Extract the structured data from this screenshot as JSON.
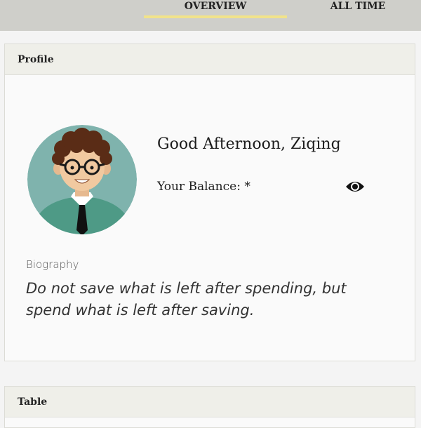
{
  "tabs": [
    {
      "label": "OVERVIEW",
      "active": true
    },
    {
      "label": "ALL TIME",
      "active": false
    }
  ],
  "profile": {
    "header": "Profile",
    "greeting": "Good Afternoon, Ziqing",
    "balance_label": "Your Balance: *",
    "toggle_icon": "eye-icon",
    "biography_label": "Biography",
    "biography_text": "Do not save what is left after spending, but spend what is left after saving."
  },
  "table": {
    "header": "Table"
  },
  "colors": {
    "topbar": "#cfcfca",
    "active_tab_underline": "#f1e38a",
    "panel_header": "#efefe9",
    "avatar_bg": "#7fb3ad"
  }
}
